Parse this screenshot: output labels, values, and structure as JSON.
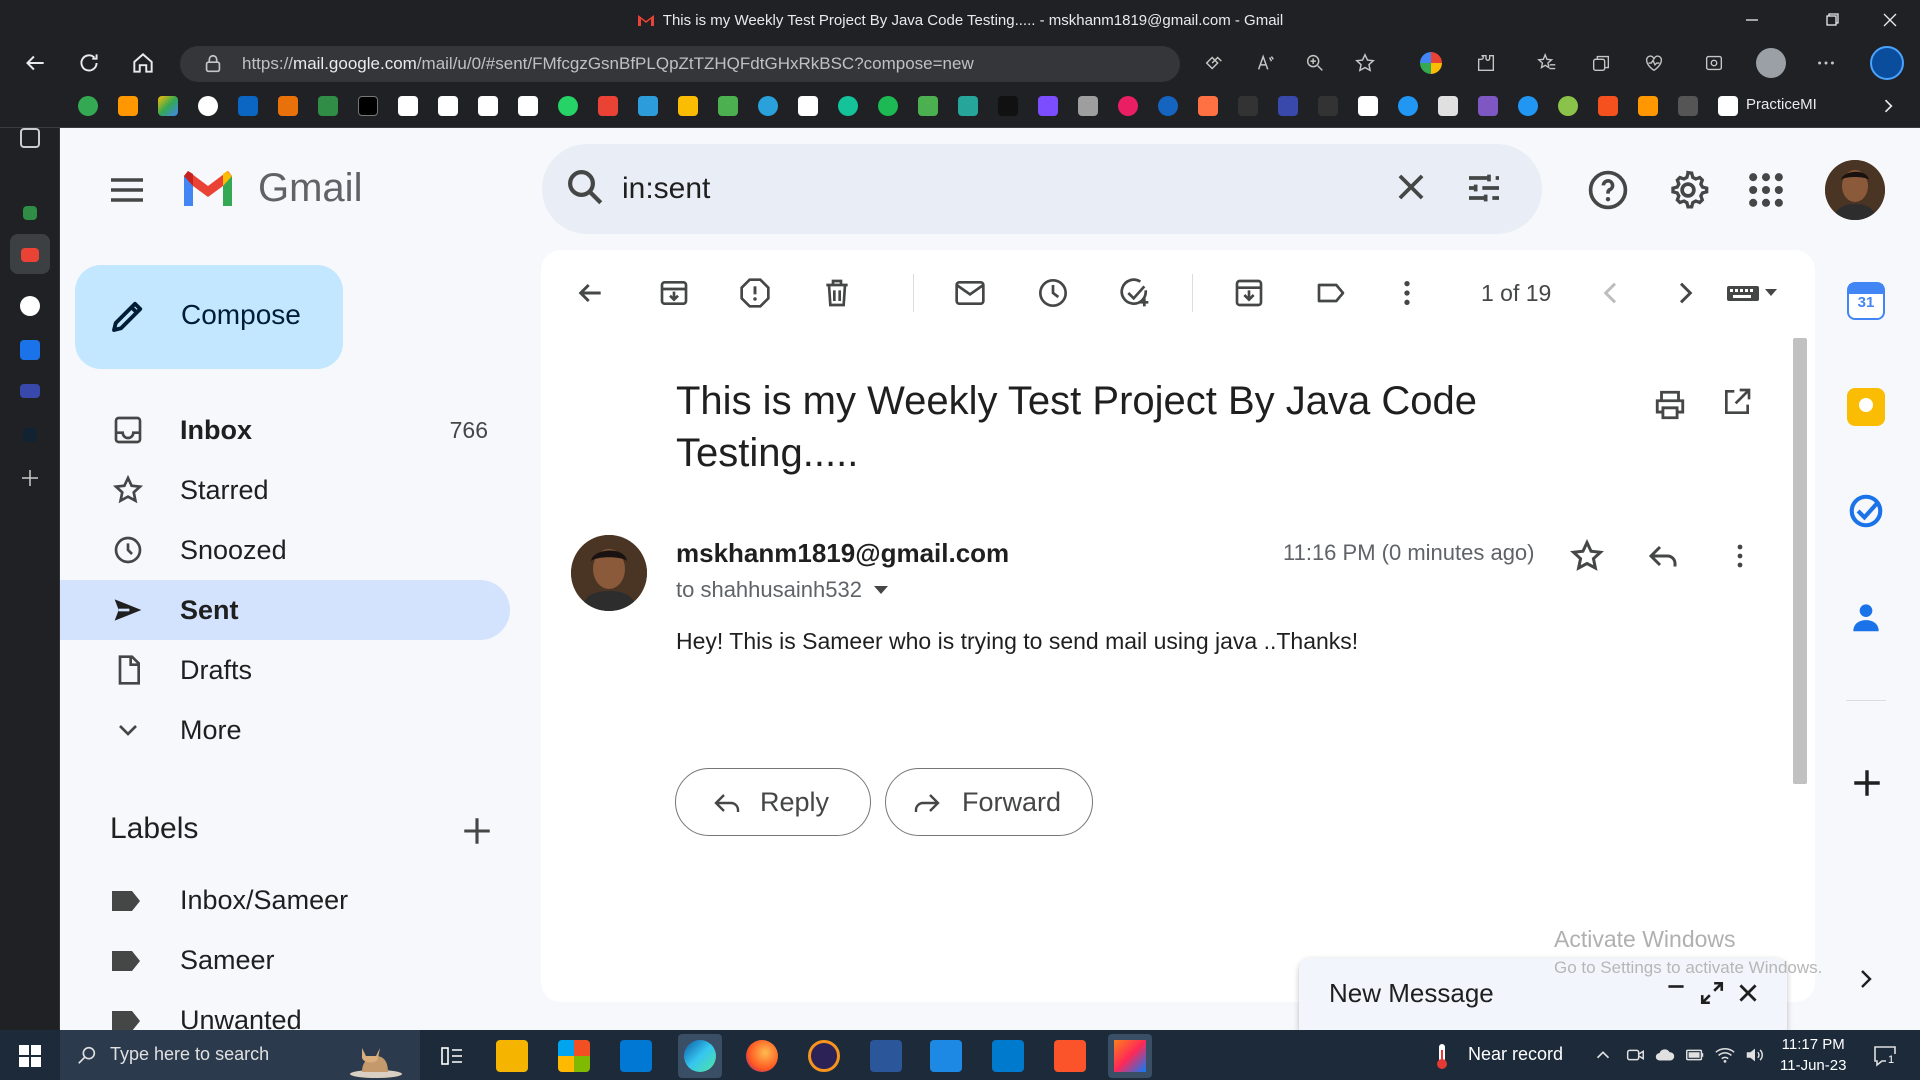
{
  "browser": {
    "title": "This is my Weekly Test Project By Java Code Testing..... - mskhanm1819@gmail.com - Gmail",
    "url_prefix": "https://",
    "url_host": "mail.google.com",
    "url_rest": "/mail/u/0/#sent/FMfcgzGsnBfPLQpZtTZHQFdtGHxRkBSC?compose=new",
    "bookmark_label": "PracticeMI"
  },
  "gmail": {
    "logo_text": "Gmail",
    "search_query": "in:sent",
    "compose_label": "Compose",
    "nav": [
      {
        "label": "Inbox",
        "count": "766"
      },
      {
        "label": "Starred",
        "count": ""
      },
      {
        "label": "Snoozed",
        "count": ""
      },
      {
        "label": "Sent",
        "count": ""
      },
      {
        "label": "Drafts",
        "count": ""
      },
      {
        "label": "More",
        "count": ""
      }
    ],
    "labels_title": "Labels",
    "labels": [
      "Inbox/Sameer",
      "Sameer",
      "Unwanted"
    ]
  },
  "message": {
    "page_count": "1 of 19",
    "subject": "This is my Weekly Test Project By Java Code Testing.....",
    "sender": "mskhanm1819@gmail.com",
    "recipient": "to shahhusainh532",
    "time": "11:16 PM (0 minutes ago)",
    "body": "Hey! This is Sameer who is trying to send mail using java ..Thanks!",
    "reply_label": "Reply",
    "forward_label": "Forward"
  },
  "compose_window": {
    "title": "New Message"
  },
  "watermark": {
    "line1": "Activate Windows",
    "line2": "Go to Settings to activate Windows."
  },
  "side_panel": {
    "calendar_day": "31"
  },
  "taskbar": {
    "search_placeholder": "Type here to search",
    "near_record": "Near record",
    "time": "11:17 PM",
    "date": "11-Jun-23",
    "notification_count": "1"
  },
  "colors": {
    "sent_active_bg": "#d3e3fd",
    "compose_bg": "#c2e7ff",
    "search_bg": "#e9eef6",
    "app_bg": "#f6f8fc"
  }
}
